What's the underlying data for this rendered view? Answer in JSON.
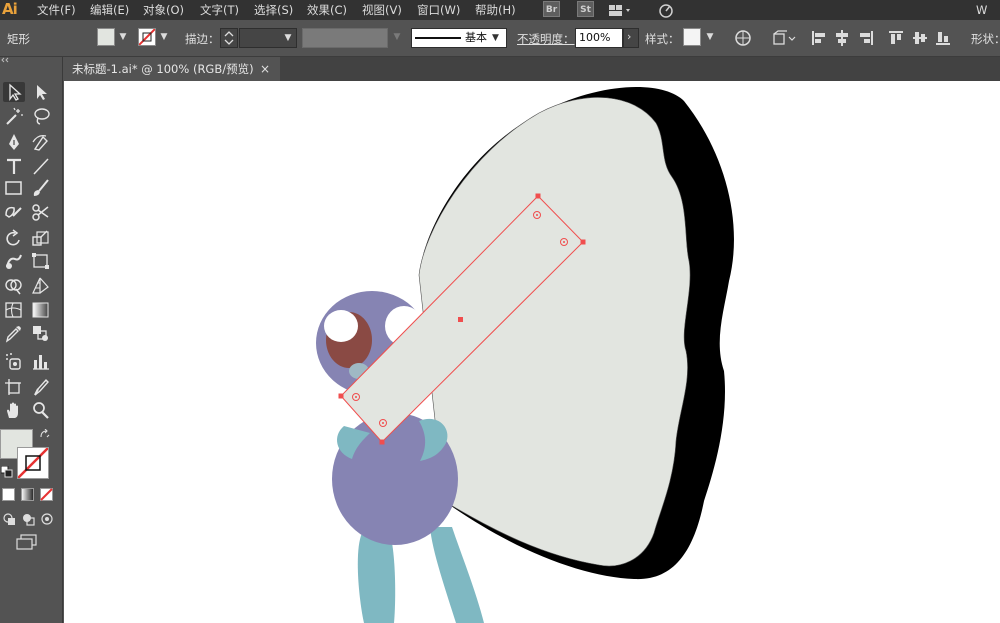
{
  "app": {
    "logo": "Ai"
  },
  "menu": {
    "items": [
      "文件(F)",
      "编辑(E)",
      "对象(O)",
      "文字(T)",
      "选择(S)",
      "效果(C)",
      "视图(V)",
      "窗口(W)",
      "帮助(H)"
    ],
    "badges": [
      "Br",
      "St"
    ],
    "right_text": "W"
  },
  "control": {
    "object_type": "矩形",
    "stroke_label": "描边：",
    "stroke_style": "基本",
    "opacity_label": "不透明度：",
    "opacity_value": "100%",
    "style_label": "样式：",
    "shape_label": "形状："
  },
  "document": {
    "tab_title": "未标题-1.ai* @ 100% (RGB/预览)",
    "close_glyph": "×"
  },
  "colors": {
    "fill": "#e2e5e0",
    "body": "#8684b3",
    "limbs": "#7fb8c2",
    "eye_pupil": "#8a4a44",
    "wing_outline": "#000000",
    "selection": "#f04e4e",
    "app_dark": "#323232",
    "app_panel": "#535353"
  },
  "tools": [
    "selection-icon",
    "direct-selection-icon",
    "magic-wand-icon",
    "lasso-icon",
    "pen-icon",
    "curvature-icon",
    "type-icon",
    "line-icon",
    "rectangle-icon",
    "paintbrush-icon",
    "shaper-icon",
    "scissors-icon",
    "rotate-icon",
    "scale-icon",
    "warp-icon",
    "free-transform-icon",
    "shape-builder-icon",
    "perspective-icon",
    "mesh-icon",
    "gradient-icon",
    "eyedropper-icon",
    "blend-icon",
    "symbol-sprayer-icon",
    "column-graph-icon",
    "artboard-icon",
    "slice-icon",
    "hand-icon",
    "zoom-icon"
  ]
}
